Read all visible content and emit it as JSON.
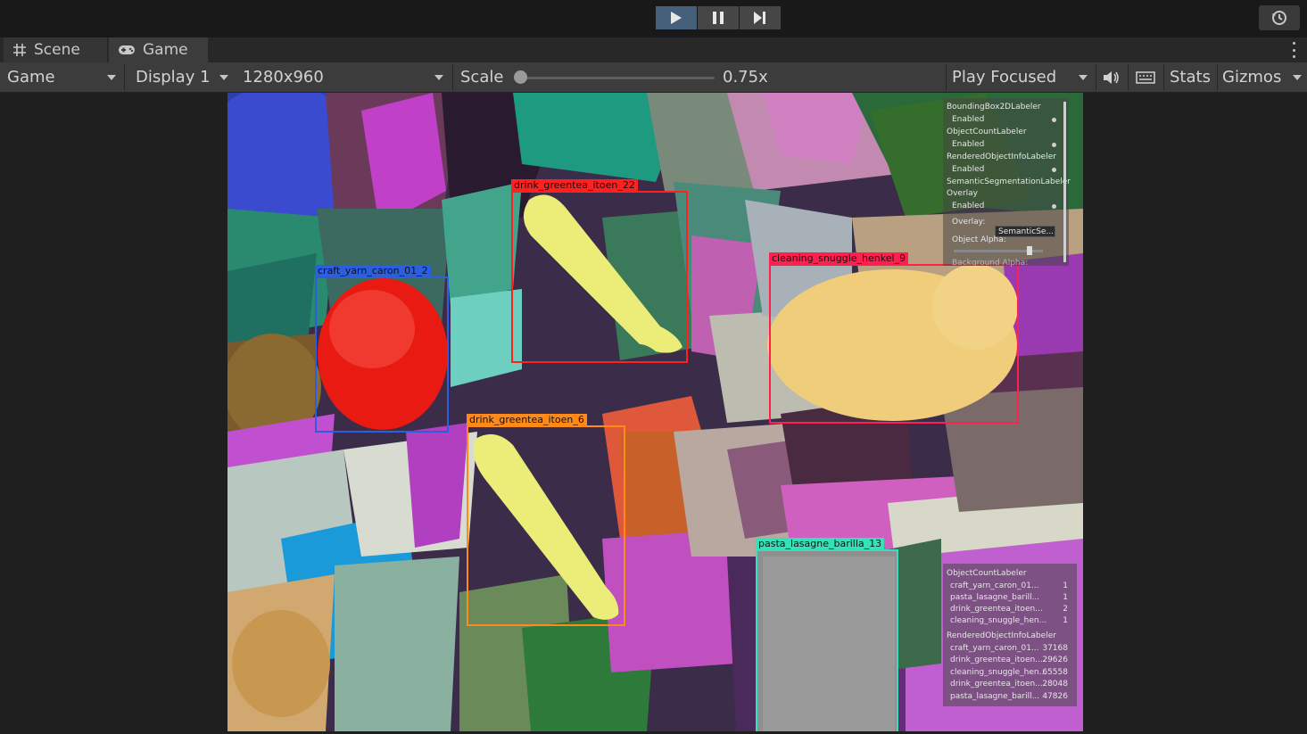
{
  "toolbar_top": {
    "play": "play-icon",
    "pause": "pause-icon",
    "step": "step-icon",
    "history": "history-icon"
  },
  "tabs": [
    {
      "label": "Scene",
      "icon": "grid-icon"
    },
    {
      "label": "Game",
      "icon": "gamepad-icon"
    }
  ],
  "game_toolbar": {
    "view_mode": "Game",
    "display": "Display 1",
    "resolution": "1280x960",
    "scale_label": "Scale",
    "scale_value": "0.75x",
    "scale_fraction": 0.0,
    "play_mode": "Play Focused",
    "stats": "Stats",
    "gizmos": "Gizmos"
  },
  "bounding_boxes": [
    {
      "label": "craft_yarn_caron_01_2",
      "color": "#2b5fe0"
    },
    {
      "label": "drink_greentea_itoen_22",
      "color": "#ff2020"
    },
    {
      "label": "cleaning_snuggle_henkel_9",
      "color": "#ff2050"
    },
    {
      "label": "drink_greentea_itoen_6",
      "color": "#ff8a1a"
    },
    {
      "label": "pasta_lasagne_barilla_13",
      "color": "#36e0b8"
    }
  ],
  "labeler_panel": {
    "items": [
      {
        "name": "BoundingBox2DLabeler",
        "state": "Enabled"
      },
      {
        "name": "ObjectCountLabeler",
        "state": "Enabled"
      },
      {
        "name": "RenderedObjectInfoLabeler",
        "state": "Enabled"
      },
      {
        "name": "SemanticSegmentationLabeler",
        "state": ""
      },
      {
        "name": "Overlay",
        "state": "Enabled"
      }
    ],
    "overlay_label": "Overlay:",
    "overlay_value": "SemanticSe...",
    "alpha_label": "Object Alpha:",
    "background_label": "Background Alpha:",
    "alpha_fraction": 0.85
  },
  "count_panel": {
    "count_title": "ObjectCountLabeler",
    "counts": [
      {
        "name": "craft_yarn_caron_01...",
        "value": "1"
      },
      {
        "name": "pasta_lasagne_barill...",
        "value": "1"
      },
      {
        "name": "drink_greentea_itoen...",
        "value": "2"
      },
      {
        "name": "cleaning_snuggle_hen...",
        "value": "1"
      }
    ],
    "info_title": "RenderedObjectInfoLabeler",
    "infos": [
      {
        "name": "craft_yarn_caron_01...",
        "value": "37168"
      },
      {
        "name": "drink_greentea_itoen...",
        "value": "29626"
      },
      {
        "name": "cleaning_snuggle_hen...",
        "value": "65558"
      },
      {
        "name": "drink_greentea_itoen...",
        "value": "28048"
      },
      {
        "name": "pasta_lasagne_barill...",
        "value": "47826"
      }
    ]
  }
}
